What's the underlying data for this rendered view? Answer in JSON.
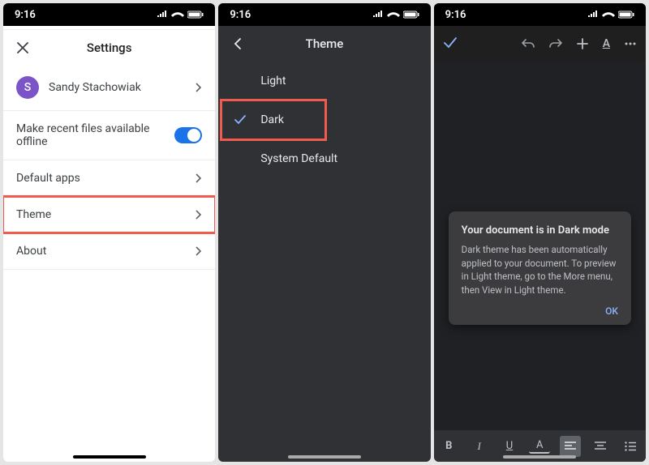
{
  "status": {
    "time": "9:16"
  },
  "settings": {
    "title": "Settings",
    "account": {
      "initial": "S",
      "name": "Sandy Stachowiak"
    },
    "offline_label": "Make recent files available offline",
    "default_apps": "Default apps",
    "theme": "Theme",
    "about": "About"
  },
  "theme_panel": {
    "title": "Theme",
    "options": {
      "light": "Light",
      "dark": "Dark",
      "system": "System Default"
    }
  },
  "doc": {
    "dialog_title": "Your document is in Dark mode",
    "dialog_body": "Dark theme has been automatically applied to your document. To preview in Light theme, go to the More menu, then View in Light theme.",
    "dialog_ok": "OK",
    "format": {
      "bold": "B",
      "italic": "I",
      "underline": "U",
      "textcolor": "A"
    }
  }
}
